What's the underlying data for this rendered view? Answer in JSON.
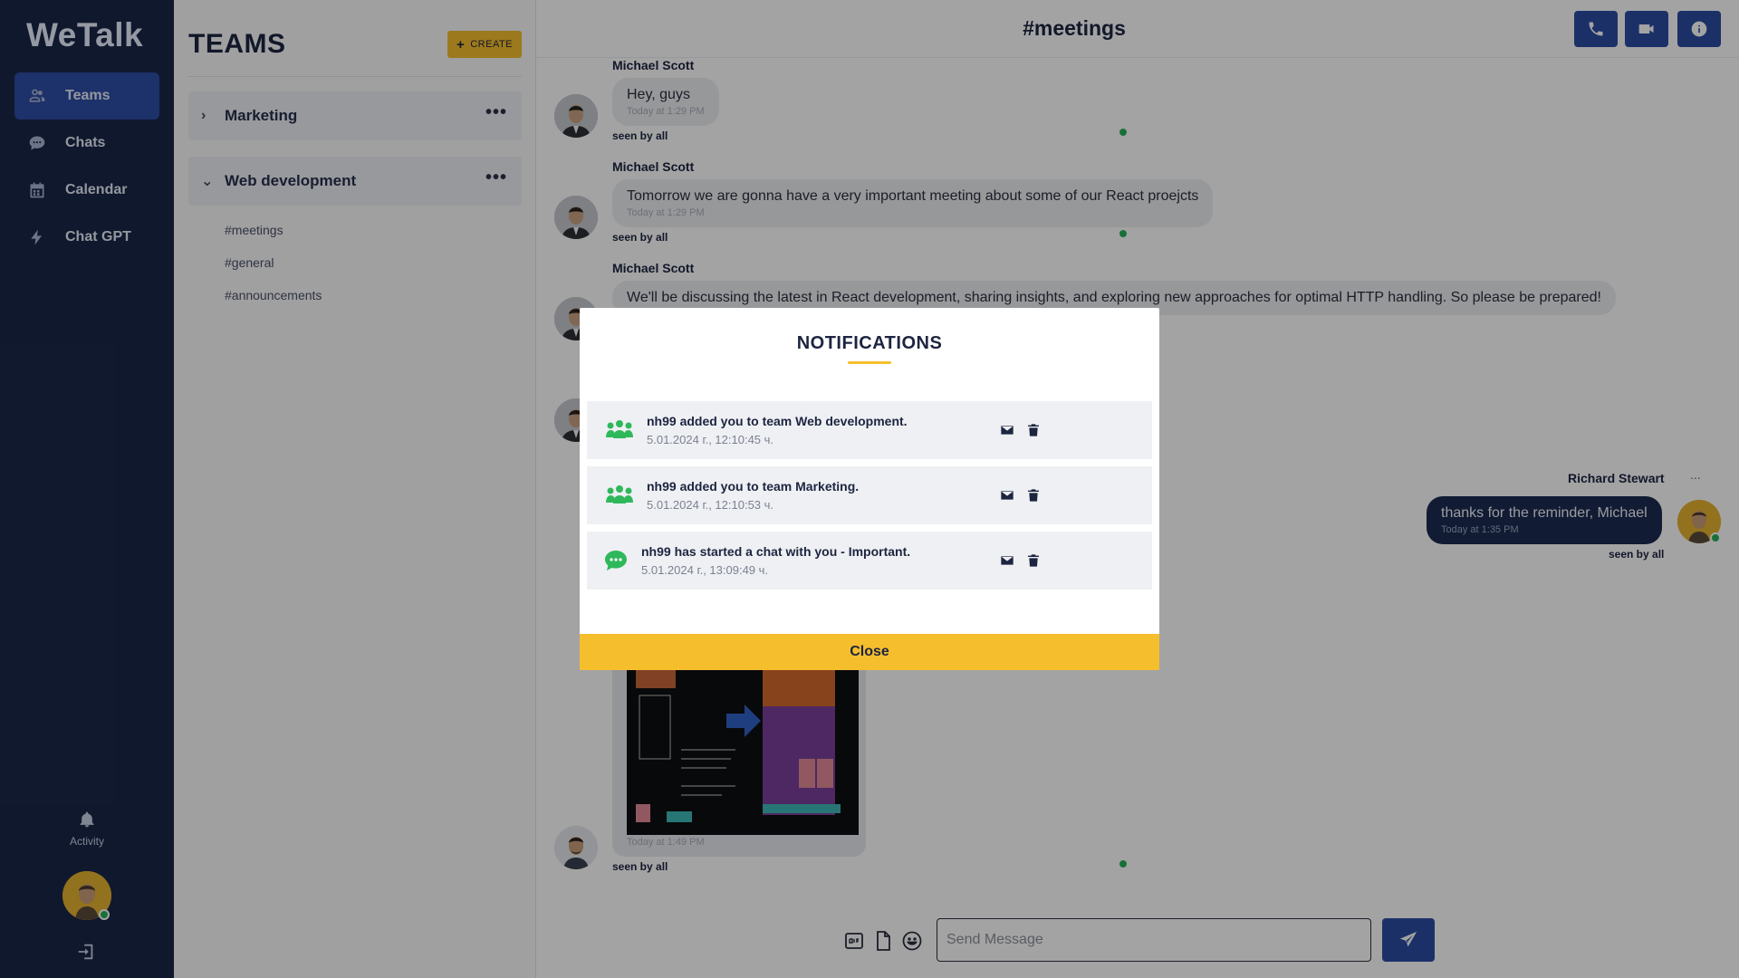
{
  "app": {
    "logo": "WeTalk"
  },
  "nav": {
    "items": [
      {
        "label": "Teams",
        "icon": "users-icon",
        "active": true
      },
      {
        "label": "Chats",
        "icon": "chat-bubble-icon",
        "active": false
      },
      {
        "label": "Calendar",
        "icon": "calendar-icon",
        "active": false
      },
      {
        "label": "Chat GPT",
        "icon": "bolt-icon",
        "active": false
      }
    ],
    "activity_label": "Activity"
  },
  "teams_panel": {
    "title": "TEAMS",
    "create_label": "CREATE",
    "teams": [
      {
        "name": "Marketing",
        "expanded": false,
        "chevron": "›"
      },
      {
        "name": "Web development",
        "expanded": true,
        "chevron": "⌄"
      }
    ],
    "channels": [
      "#meetings",
      "#general",
      "#announcements"
    ]
  },
  "chat": {
    "title": "#meetings",
    "messages": [
      {
        "sender": "Michael Scott",
        "text": "Hey, guys",
        "time": "Today at 1:29 PM",
        "seen": "seen by all"
      },
      {
        "sender": "Michael Scott",
        "text": "Tomorrow we are gonna have a very important meeting about some of our React proejcts",
        "time": "Today at 1:29 PM",
        "seen": "seen by all"
      },
      {
        "sender": "Michael Scott",
        "text": "We'll be discussing the latest in React development, sharing insights, and exploring new approaches for optimal HTTP handling. So please be prepared!"
      }
    ],
    "own_message": {
      "sender": "Richard Stewart",
      "menu": "...",
      "text": "thanks for the reminder, Michael",
      "time": "Today at 1:35 PM",
      "seen": "seen by all"
    },
    "image_message": {
      "time": "Today at 1:49 PM",
      "seen": "seen by all"
    },
    "composer": {
      "placeholder": "Send Message"
    }
  },
  "notifications": {
    "title": "NOTIFICATIONS",
    "items": [
      {
        "icon": "team-icon",
        "text": "nh99 added you to team Web development.",
        "date": "5.01.2024 г., 12:10:45 ч."
      },
      {
        "icon": "team-icon",
        "text": "nh99 added you to team Marketing.",
        "date": "5.01.2024 г., 12:10:53 ч."
      },
      {
        "icon": "chat-icon",
        "text": "nh99 has started a chat with you - Important.",
        "date": "5.01.2024 г., 13:09:49 ч."
      }
    ],
    "close_label": "Close"
  },
  "colors": {
    "nav_bg": "#1a2748",
    "accent_blue": "#2d4ca3",
    "accent_yellow": "#f5be2c",
    "online_green": "#26b05a",
    "notif_icon_green": "#2fb85b"
  }
}
